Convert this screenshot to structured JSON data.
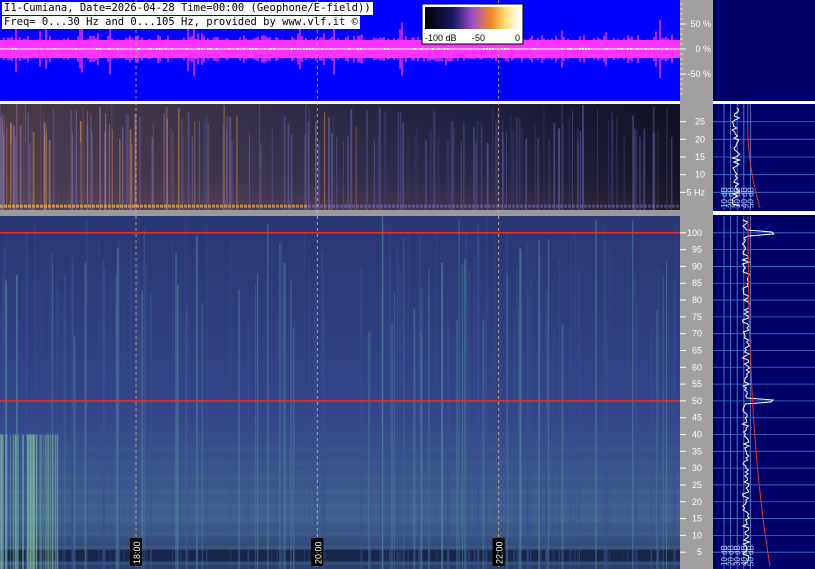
{
  "header": {
    "line1": "I1-Cumiana, Date=2026-04-28 Time=00:00 (Geophone/E-field))",
    "line2": "Freq= 0...30 Hz and 0...105 Hz, provided by www.vlf.it ©"
  },
  "colorbar": {
    "ticks": [
      "-100 dB",
      "-50",
      "0"
    ],
    "stops": [
      "#000000",
      "#1a1a66",
      "#a04ec8",
      "#f08a20",
      "#ffe07a",
      "#ffffff"
    ]
  },
  "colors": {
    "waveform_bg": "#0000ff",
    "waveform": "#ff33ff",
    "spectro_top_bg": "#1b1e3a",
    "spectro_main_bg": "#2e3a78",
    "side_bg": "#00006a",
    "axis_strip": "#a0a0a0",
    "marker_line": "#e03030",
    "grid_line": "#3a78c8"
  },
  "chart_data": [
    {
      "type": "line",
      "name": "amplitude-waveform",
      "ylabel_ticks": [
        "50 %",
        "0 %",
        "-50 %"
      ],
      "yrange_percent": [
        -100,
        100
      ],
      "mean_level_percent": 0
    },
    {
      "type": "heatmap",
      "name": "spectrogram-low",
      "yrange_hz": [
        0,
        30
      ],
      "yticks": [
        "25",
        "20",
        "15",
        "10",
        "5 Hz"
      ],
      "ytick_values": [
        25,
        20,
        15,
        10,
        5
      ]
    },
    {
      "type": "heatmap",
      "name": "spectrogram-high",
      "yrange_hz": [
        0,
        105
      ],
      "yticks": [
        "100",
        "95",
        "90",
        "85",
        "80",
        "75",
        "70",
        "65",
        "60",
        "55",
        "50",
        "45",
        "40",
        "35",
        "30",
        "25",
        "20",
        "15",
        "10",
        "5"
      ],
      "ytick_values": [
        100,
        95,
        90,
        85,
        80,
        75,
        70,
        65,
        60,
        55,
        50,
        45,
        40,
        35,
        30,
        25,
        20,
        15,
        10,
        5
      ],
      "time_labels": [
        "18:00",
        "20:00",
        "22:00"
      ],
      "time_hours": [
        18,
        20,
        22
      ],
      "time_range_hours": [
        16.5,
        24
      ],
      "tone_lines_hz": [
        100,
        50
      ]
    },
    {
      "type": "line",
      "name": "spectrum-profile-low",
      "x_ticks": [
        "10 dB",
        "20 dB",
        "30 dB",
        "40 dB",
        "50 dB"
      ],
      "x_values_db": [
        10,
        20,
        30,
        40,
        50
      ]
    },
    {
      "type": "line",
      "name": "spectrum-profile-high",
      "x_ticks": [
        "10 dB",
        "20 dB",
        "30 dB",
        "40 dB",
        "50 dB"
      ],
      "x_values_db": [
        10,
        20,
        30,
        40,
        50
      ],
      "peaks_hz": [
        100,
        50
      ]
    }
  ]
}
